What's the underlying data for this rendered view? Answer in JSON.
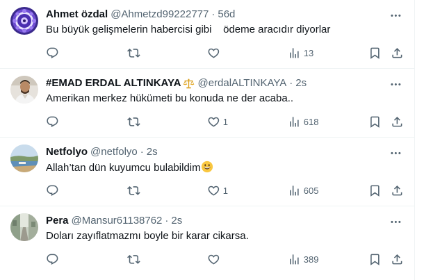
{
  "replies": [
    {
      "name": "Ahmet özdal",
      "handle": "@Ahmetzd99222777",
      "sep": "·",
      "time": "56d",
      "text": "Bu büyük gelişmelerin habercisi gibi    ödeme aracıdır diyorlar",
      "likes": "",
      "views": "13",
      "avatar_icon": "mandala-avatar"
    },
    {
      "name": "#EMAD ERDAL ALTINKAYA",
      "handle": "@erdalALTINKAYA",
      "sep": "·",
      "time": "2s",
      "text": "Amerikan merkez hükümeti bu konuda ne der acaba..",
      "likes": "1",
      "views": "618",
      "avatar_icon": "man-avatar",
      "badge_icon": "scales-emoji"
    },
    {
      "name": "Netfolyo",
      "handle": "@netfolyo",
      "sep": "·",
      "time": "2s",
      "text": "Allah’tan dün kuyumcu bulabildim",
      "likes": "1",
      "views": "605",
      "avatar_icon": "seaside-avatar",
      "emoji_icon": "grinning-face-emoji"
    },
    {
      "name": "Pera",
      "handle": "@Mansur61138762",
      "sep": "·",
      "time": "2s",
      "text": "Doları zayıflatmazmı boyle bir karar cikarsa.",
      "likes": "",
      "views": "389",
      "avatar_icon": "street-avatar"
    }
  ],
  "colors": {
    "text": "#0f1419",
    "secondary": "#536471",
    "border": "#eff3f4"
  }
}
